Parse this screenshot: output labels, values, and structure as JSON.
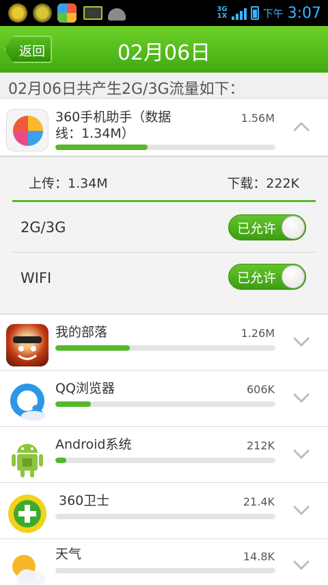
{
  "status_bar": {
    "network_top": "3G",
    "network_bottom": "1X",
    "ampm": "下午",
    "time": "3:07"
  },
  "header": {
    "back_label": "返回",
    "title": "02月06日"
  },
  "summary": "02月06日共产生2G/3G流量如下：",
  "expanded_app": {
    "name_line1": "360手机助手（数据",
    "name_line2": "线：1.34M）",
    "size": "1.56M",
    "progress": 0.42,
    "upload": "上传：1.34M",
    "download": "下载：222K",
    "networks": [
      {
        "label": "2G/3G",
        "toggle": "已允许",
        "enabled": true
      },
      {
        "label": "WIFI",
        "toggle": "已允许",
        "enabled": true
      }
    ]
  },
  "apps": [
    {
      "name": "我的部落",
      "size": "1.26M",
      "progress": 0.34,
      "icon": "game-tribe-icon"
    },
    {
      "name": "QQ浏览器",
      "size": "606K",
      "progress": 0.16,
      "icon": "qq-browser-icon"
    },
    {
      "name": "Android系统",
      "size": "212K",
      "progress": 0.05,
      "icon": "android-icon"
    },
    {
      "name": "360卫士",
      "size": "21.4K",
      "progress": 0.0,
      "icon": "360-guard-icon"
    },
    {
      "name": "天气",
      "size": "14.8K",
      "progress": 0.0,
      "icon": "weather-icon"
    }
  ],
  "colors": {
    "accent": "#4cb51b",
    "progress": "#55b82b",
    "status_text": "#38b6ff"
  }
}
